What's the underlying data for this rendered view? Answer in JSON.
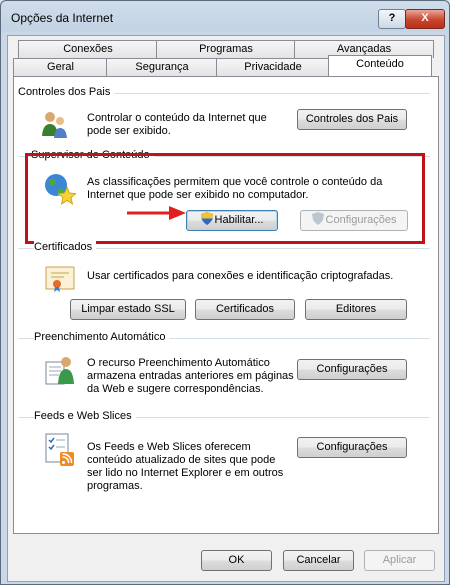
{
  "window": {
    "title": "Opções da Internet"
  },
  "titlebar": {
    "help_label": "?",
    "close_label": "X"
  },
  "tabs": {
    "row1": [
      "Conexões",
      "Programas",
      "Avançadas"
    ],
    "row2": [
      "Geral",
      "Segurança",
      "Privacidade",
      "Conteúdo"
    ],
    "active": "Conteúdo"
  },
  "parental": {
    "title": "Controles dos Pais",
    "text": "Controlar o conteúdo da Internet que pode ser exibido.",
    "button": "Controles dos Pais"
  },
  "supervisor": {
    "title": "Supervisor de Conteúdo",
    "text": "As classificações permitem que você controle o conteúdo da Internet que pode ser exibido no computador.",
    "enable_button": "Habilitar...",
    "settings_button": "Configurações"
  },
  "certificates": {
    "title": "Certificados",
    "text": "Usar certificados para conexões e identificação criptografadas.",
    "clear_ssl_button": "Limpar estado SSL",
    "certificates_button": "Certificados",
    "publishers_button": "Editores"
  },
  "autocomplete": {
    "title": "Preenchimento Automático",
    "text": "O recurso Preenchimento Automático armazena entradas anteriores em páginas da Web e sugere correspondências.",
    "settings_button": "Configurações"
  },
  "feeds": {
    "title": "Feeds e Web Slices",
    "text": "Os Feeds e Web Slices oferecem conteúdo atualizado de sites que pode ser lido no Internet Explorer e em outros programas.",
    "settings_button": "Configurações"
  },
  "footer": {
    "ok": "OK",
    "cancel": "Cancelar",
    "apply": "Aplicar"
  },
  "colors": {
    "highlight_box": "#c1121b",
    "arrow": "#e0201c"
  },
  "icons": [
    "parental-controls-icon",
    "content-advisor-icon",
    "certificate-icon",
    "autocomplete-icon",
    "feeds-icon",
    "shield-icon",
    "arrow-icon"
  ]
}
